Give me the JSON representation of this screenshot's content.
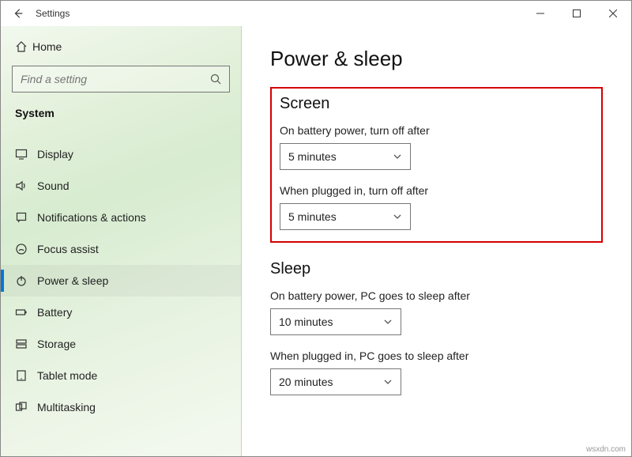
{
  "window": {
    "title": "Settings"
  },
  "sidebar": {
    "home_label": "Home",
    "search_placeholder": "Find a setting",
    "group_label": "System",
    "items": [
      {
        "icon": "display-icon",
        "label": "Display"
      },
      {
        "icon": "sound-icon",
        "label": "Sound"
      },
      {
        "icon": "notifications-icon",
        "label": "Notifications & actions"
      },
      {
        "icon": "focus-icon",
        "label": "Focus assist"
      },
      {
        "icon": "power-icon",
        "label": "Power & sleep"
      },
      {
        "icon": "battery-icon",
        "label": "Battery"
      },
      {
        "icon": "storage-icon",
        "label": "Storage"
      },
      {
        "icon": "tablet-icon",
        "label": "Tablet mode"
      },
      {
        "icon": "multitask-icon",
        "label": "Multitasking"
      }
    ],
    "active_index": 4
  },
  "main": {
    "title": "Power & sleep",
    "screen": {
      "title": "Screen",
      "battery_label": "On battery power, turn off after",
      "battery_value": "5 minutes",
      "plugged_label": "When plugged in, turn off after",
      "plugged_value": "5 minutes"
    },
    "sleep": {
      "title": "Sleep",
      "battery_label": "On battery power, PC goes to sleep after",
      "battery_value": "10 minutes",
      "plugged_label": "When plugged in, PC goes to sleep after",
      "plugged_value": "20 minutes"
    }
  },
  "watermark": "wsxdn.com"
}
